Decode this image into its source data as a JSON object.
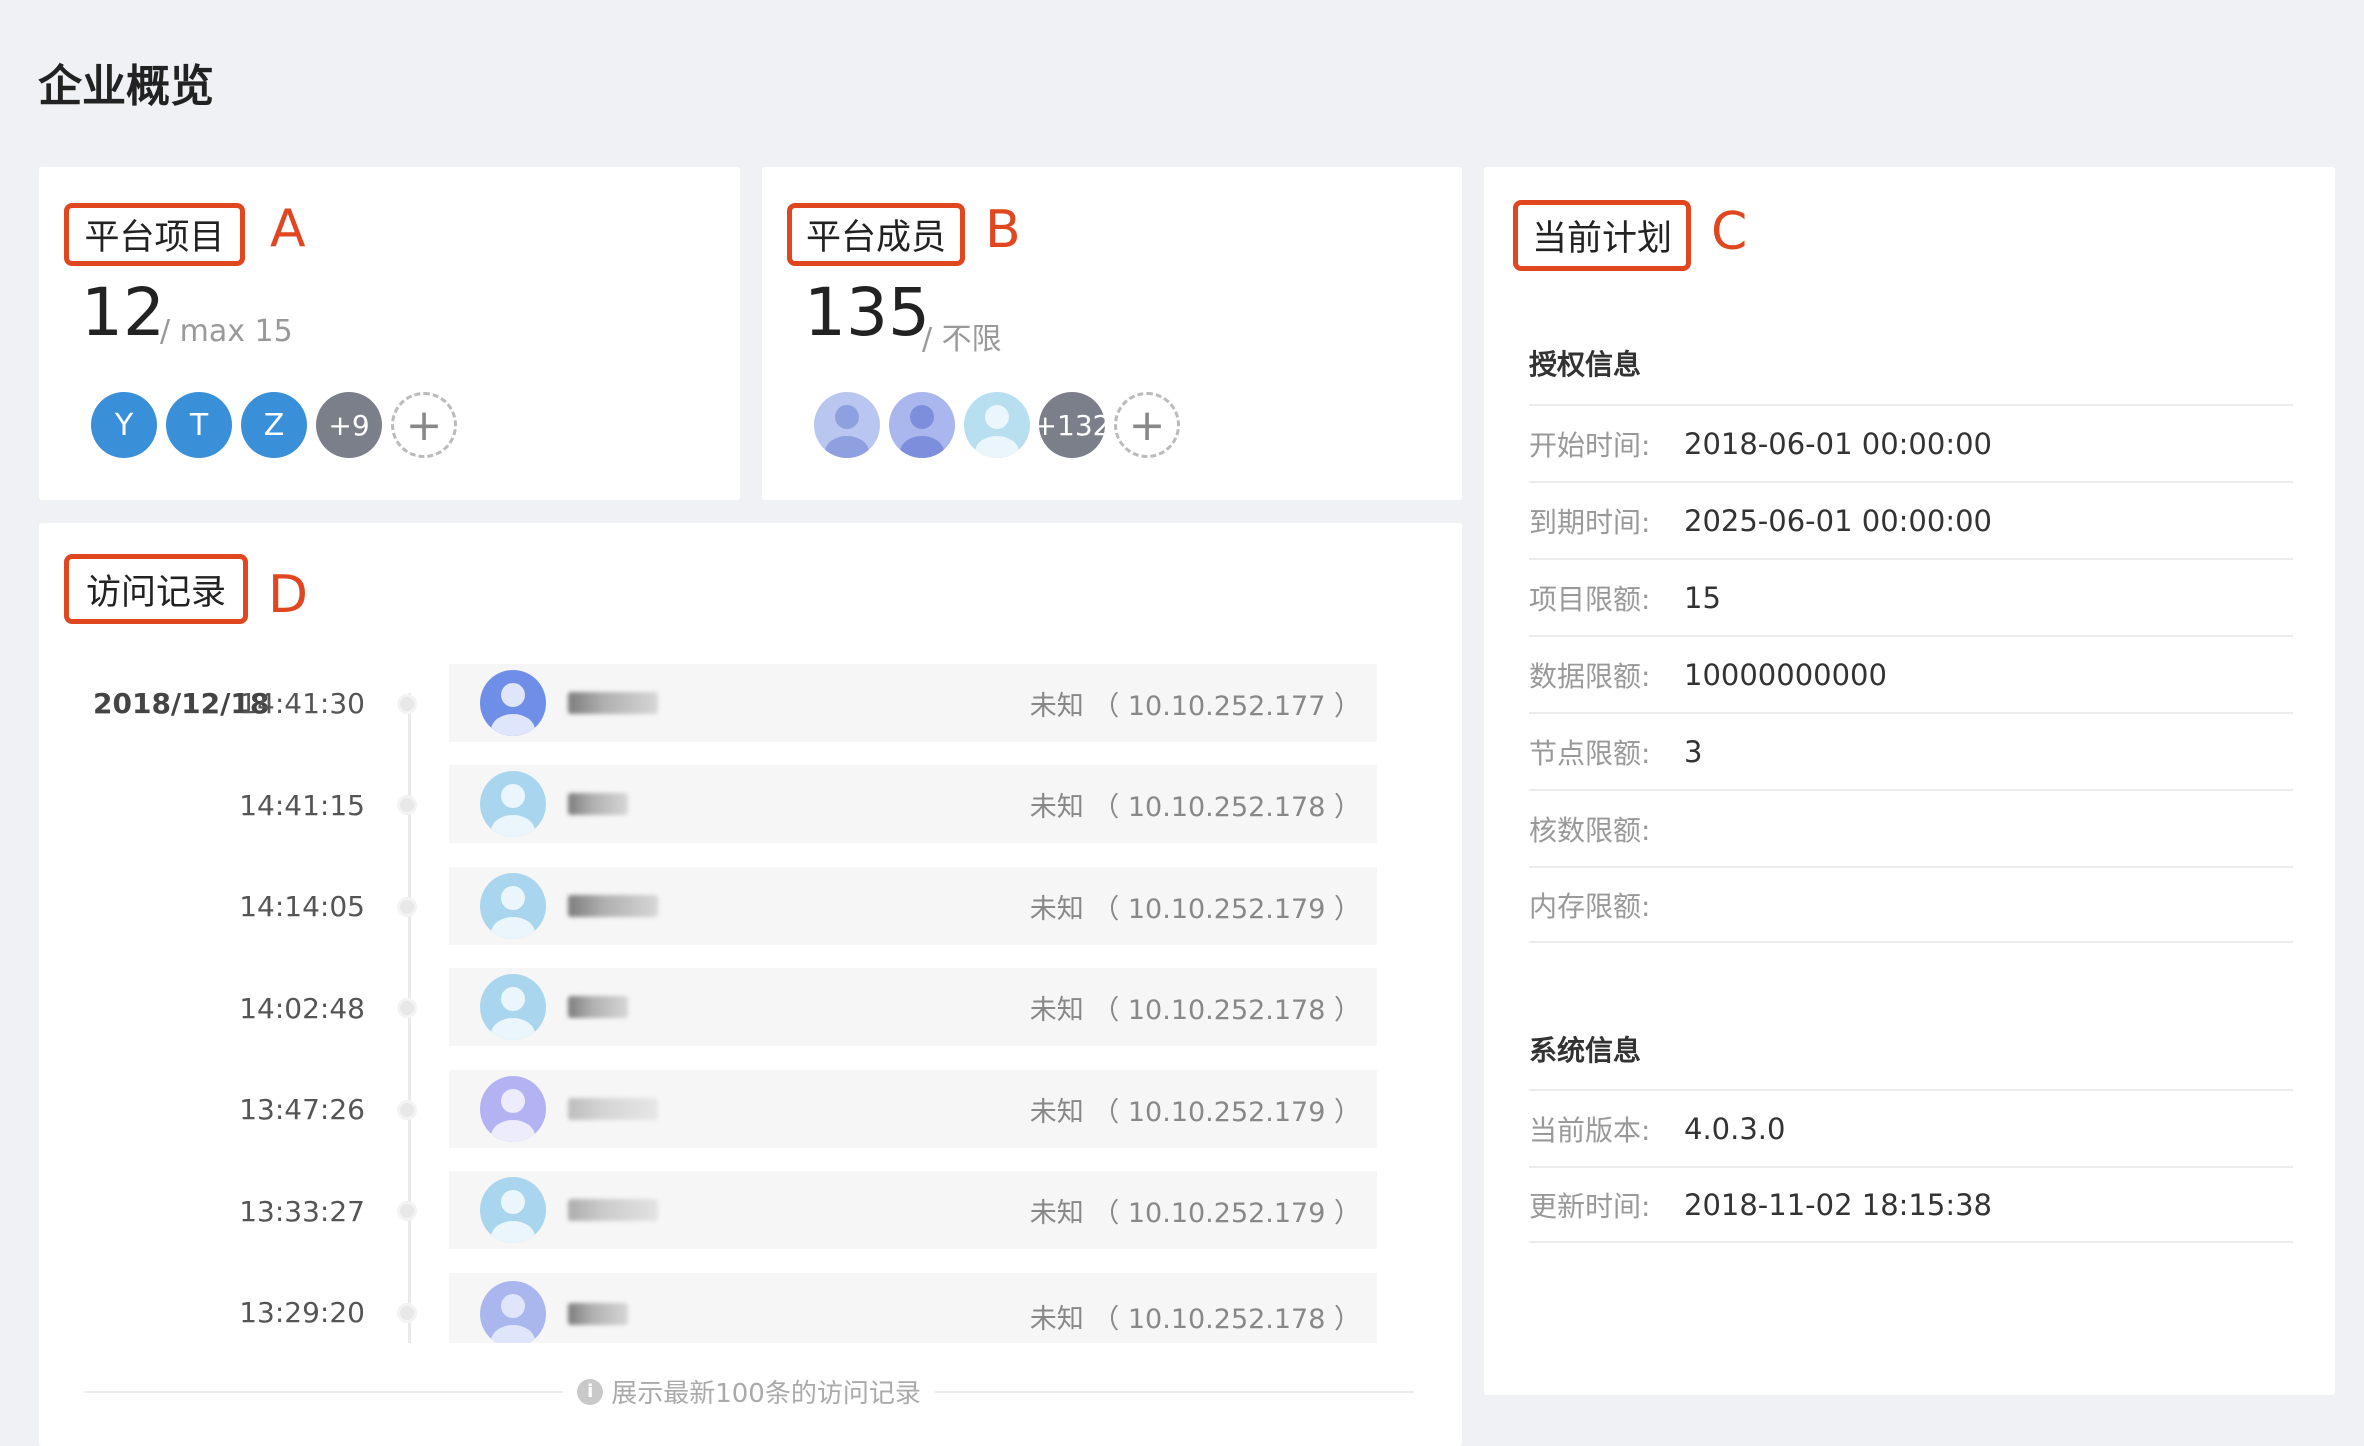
{
  "page_title": "企业概览",
  "platform_projects": {
    "title": "平台项目",
    "marker": "A",
    "count": "12",
    "limit": "/ max 15",
    "avatars": [
      "Y",
      "T",
      "Z"
    ],
    "more": "+9",
    "add": "+"
  },
  "platform_members": {
    "title": "平台成员",
    "marker": "B",
    "count": "135",
    "limit": "/ 不限",
    "more": "+132",
    "add": "+"
  },
  "current_plan": {
    "title": "当前计划",
    "marker": "C",
    "license_section": "授权信息",
    "license_rows": [
      {
        "label": "开始时间:",
        "value": "2018-06-01 00:00:00"
      },
      {
        "label": "到期时间:",
        "value": "2025-06-01 00:00:00"
      },
      {
        "label": "项目限额:",
        "value": "15"
      },
      {
        "label": "数据限额:",
        "value": "10000000000"
      },
      {
        "label": "节点限额:",
        "value": "3"
      },
      {
        "label": "核数限额:",
        "value": ""
      },
      {
        "label": "内存限额:",
        "value": ""
      }
    ],
    "system_section": "系统信息",
    "system_rows": [
      {
        "label": "当前版本:",
        "value": "4.0.3.0"
      },
      {
        "label": "更新时间:",
        "value": "2018-11-02 18:15:38"
      }
    ]
  },
  "visit_log": {
    "title": "访问记录",
    "marker": "D",
    "date": "2018/12/18",
    "entries": [
      {
        "time": "14:41:30",
        "location": "未知 （ 10.10.252.177 ）"
      },
      {
        "time": "14:41:15",
        "location": "未知 （ 10.10.252.178 ）"
      },
      {
        "time": "14:14:05",
        "location": "未知 （ 10.10.252.179 ）"
      },
      {
        "time": "14:02:48",
        "location": "未知 （ 10.10.252.178 ）"
      },
      {
        "time": "13:47:26",
        "location": "未知 （ 10.10.252.179 ）"
      },
      {
        "time": "13:33:27",
        "location": "未知 （ 10.10.252.179 ）"
      },
      {
        "time": "13:29:20",
        "location": "未知 （ 10.10.252.178 ）"
      }
    ],
    "footer_note": "展示最新100条的访问记录",
    "footer_icon": "i"
  },
  "colors": {
    "annotation": "#e0461f",
    "avatar_blue": "#3a8fd9",
    "avatar_more": "#7a7f8a"
  }
}
